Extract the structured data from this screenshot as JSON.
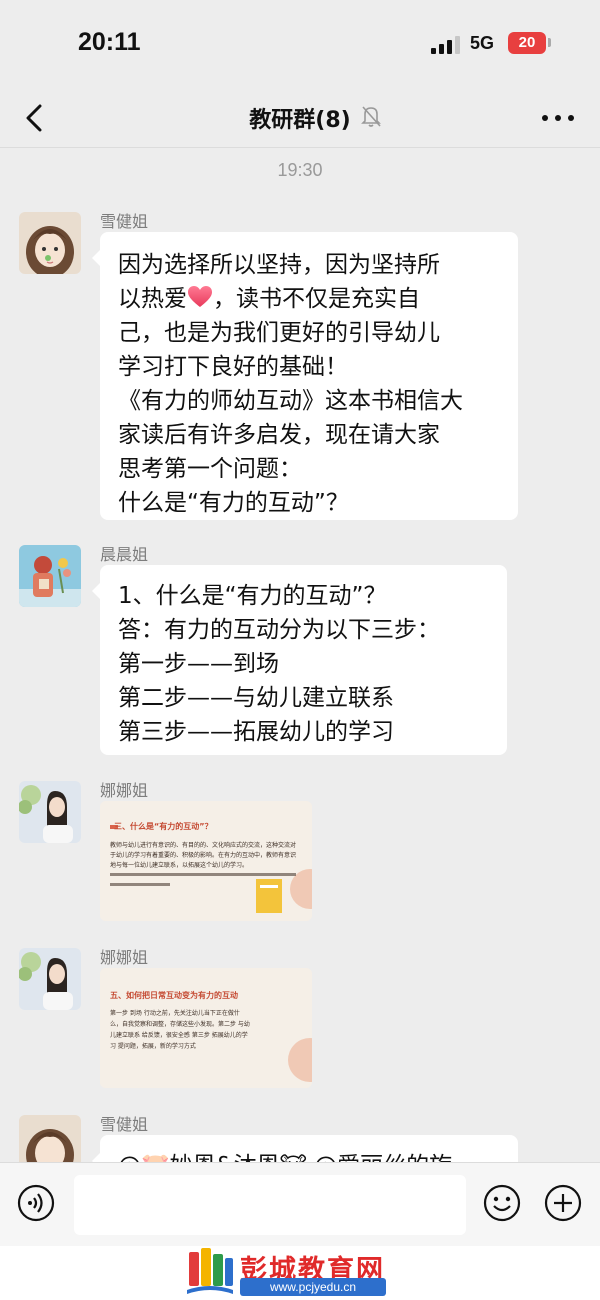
{
  "status_bar": {
    "time": "20:11",
    "network": "5G",
    "battery": "20",
    "battery_color": "#e83f3f"
  },
  "nav": {
    "title": "教研群(8)",
    "back_icon": "chevron-left-icon",
    "mute_icon": "bell-muted-icon",
    "more_icon": "ellipsis-icon"
  },
  "chat": {
    "timestamp": "19:30",
    "messages": [
      {
        "sender": "雪健姐",
        "type": "text",
        "lines": [
          "因为选择所以坚持，因为坚持所",
          "以热爱",
          "，读书不仅是充实自",
          "己，也是为我们更好的引导幼儿",
          "学习打下良好的基础！",
          "《有力的师幼互动》这本书相信大",
          "家读后有许多启发，现在请大家",
          "思考第一个问题：",
          " 什么是“有力的互动”？"
        ]
      },
      {
        "sender": "晨晨姐",
        "type": "text",
        "lines": [
          "1、什么是“有力的互动”？",
          "答：有力的互动分为以下三步：",
          "第一步——到场",
          "第二步——与幼儿建立联系",
          "第三步——拓展幼儿的学习"
        ]
      },
      {
        "sender": "娜娜姐",
        "type": "image",
        "image": {
          "heading": "三、什么是“有力的互动”？",
          "body": "教师与幼儿进行有意识的、有目的的、文化响应式的交流，这种交流对于幼儿的学习有着重要的、积极的影响。在有力的互动中，教师有意识地与每一位幼儿建立联系，以拓展这个幼儿的学习。"
        }
      },
      {
        "sender": "娜娜姐",
        "type": "image",
        "image": {
          "heading": "五、如何把日常互动变为有力的互动",
          "body": "第一步 到场 行动之前，先关注幼儿当下正在做什么，自我觉察和调整，存储这些小发现。第二步 与幼儿建立联系 给反馈，很安全感 第三步 拓展幼儿的学习 提问题，拓展，新的学习方式"
        }
      },
      {
        "sender": "雪健姐",
        "type": "text",
        "lines": [
          "@🐷妙恩&沐恩🐮 @爱丽丝的旋"
        ]
      }
    ]
  },
  "input_bar": {
    "placeholder": "",
    "voice_icon": "voice-icon",
    "emoji_icon": "emoji-icon",
    "plus_icon": "plus-icon"
  },
  "watermark": {
    "title": "彭城教育网",
    "url": "www.pcjyedu.cn"
  }
}
